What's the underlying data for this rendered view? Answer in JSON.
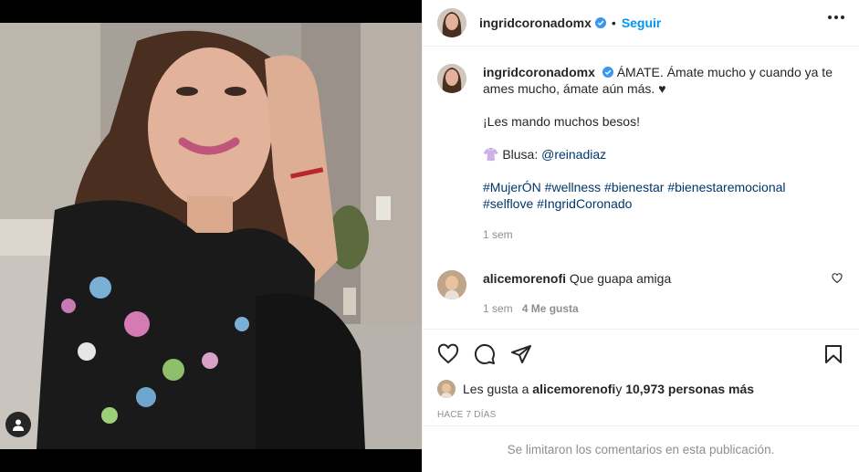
{
  "post": {
    "username": "ingridcoronadomx",
    "follow_label": "Seguir",
    "separator": "•"
  },
  "caption": {
    "username": "ingridcoronadomx",
    "text": "ÁMATE. Ámate mucho y cuando ya te ames mucho, ámate aún más. ♥",
    "line2": "¡Les mando muchos besos!",
    "blouse_prefix": "👚 Blusa: ",
    "blouse_handle": "@reinadiaz",
    "hashtags_line1": "#MujerÓN #wellness #bienestar #bienestaremocional",
    "hashtags_line2": "#selflove #IngridCoronado",
    "time": "1 sem"
  },
  "comment": {
    "username": "alicemorenofi",
    "text": "Que guapa amiga",
    "time": "1 sem",
    "likes": "4 Me gusta"
  },
  "likes": {
    "prefix": "Les gusta a ",
    "user": "alicemorenofi",
    "middle": " y ",
    "count": "10,973 personas más"
  },
  "time_ago": "HACE 7 DÍAS",
  "footer_text": "Se limitaron los comentarios en esta publicación.",
  "colors": {
    "link": "#00376b",
    "follow": "#0095f6",
    "verified": "#3897f0",
    "muted": "#8e8e8e"
  },
  "icons": [
    "user-tag-icon",
    "verified-icon",
    "more-icon",
    "heart-icon",
    "comment-icon",
    "share-icon",
    "bookmark-icon"
  ]
}
